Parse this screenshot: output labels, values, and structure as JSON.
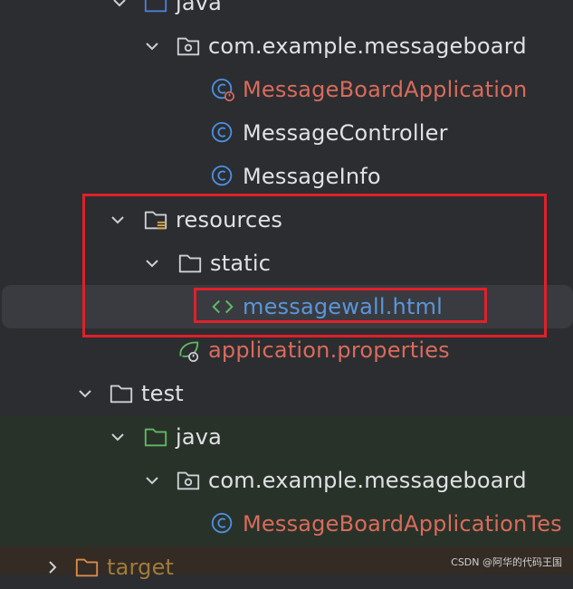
{
  "tree": {
    "items": [
      {
        "label": "java"
      },
      {
        "label": "com.example.messageboard"
      },
      {
        "label": "MessageBoardApplication"
      },
      {
        "label": "MessageController"
      },
      {
        "label": "MessageInfo"
      },
      {
        "label": "resources"
      },
      {
        "label": "static"
      },
      {
        "label": "messagewall.html"
      },
      {
        "label": "application.properties"
      },
      {
        "label": "test"
      },
      {
        "label": "java"
      },
      {
        "label": "com.example.messageboard"
      },
      {
        "label": "MessageBoardApplicationTes"
      },
      {
        "label": "target"
      }
    ]
  },
  "watermark": "CSDN @阿华的代码王国",
  "colors": {
    "background": "#2b2d30",
    "selected_row": "#393b40",
    "text_default": "#dfe1e5",
    "text_modified": "#d96b5c",
    "text_link": "#5a96d8",
    "highlight_box": "#e0202a"
  }
}
